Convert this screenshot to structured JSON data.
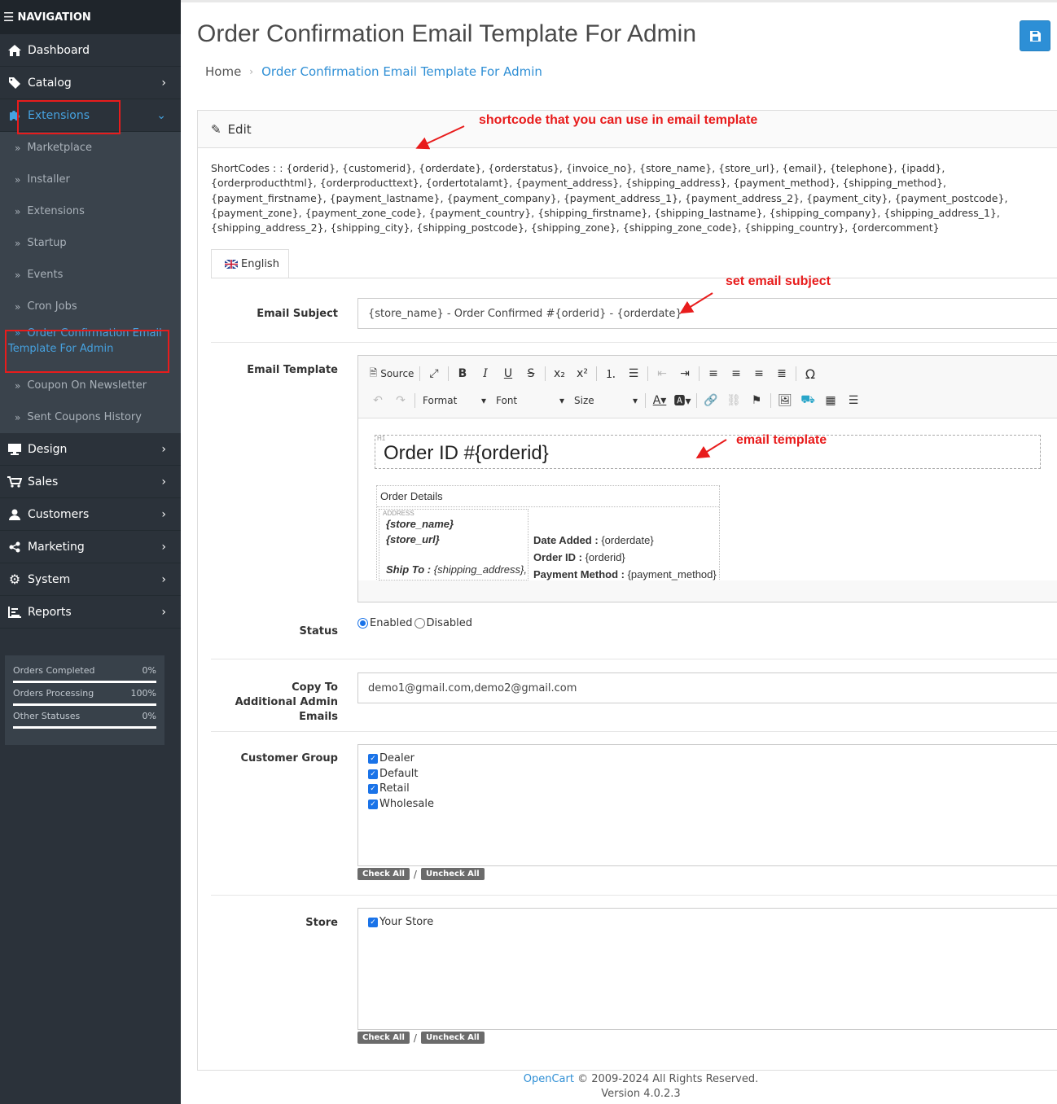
{
  "nav": {
    "header": "NAVIGATION",
    "items": [
      {
        "label": "Dashboard",
        "icon": "home-icon"
      },
      {
        "label": "Catalog",
        "icon": "tag-icon"
      },
      {
        "label": "Extensions",
        "icon": "puzzle-icon"
      },
      {
        "label": "Design",
        "icon": "monitor-icon"
      },
      {
        "label": "Sales",
        "icon": "cart-icon"
      },
      {
        "label": "Customers",
        "icon": "user-icon"
      },
      {
        "label": "Marketing",
        "icon": "share-icon"
      },
      {
        "label": "System",
        "icon": "gear-icon"
      },
      {
        "label": "Reports",
        "icon": "chart-icon"
      }
    ],
    "sub": [
      "Marketplace",
      "Installer",
      "Extensions",
      "Startup",
      "Events",
      "Cron Jobs",
      "Order Confirmation Email Template For Admin",
      "Coupon On Newsletter",
      "Sent Coupons History"
    ],
    "stats": [
      {
        "label": "Orders Completed",
        "value": "0%"
      },
      {
        "label": "Orders Processing",
        "value": "100%"
      },
      {
        "label": "Other Statuses",
        "value": "0%"
      }
    ]
  },
  "page": {
    "title": "Order Confirmation Email Template For Admin",
    "breadcrumb": {
      "home": "Home",
      "current": "Order Confirmation Email Template For Admin"
    },
    "panel_title": "Edit",
    "shortcodes": "ShortCodes : : {orderid}, {customerid}, {orderdate}, {orderstatus}, {invoice_no}, {store_name}, {store_url}, {email}, {telephone}, {ipadd}, {orderproducthtml}, {orderproducttext}, {ordertotalamt}, {payment_address}, {shipping_address}, {payment_method}, {shipping_method}, {payment_firstname}, {payment_lastname}, {payment_company}, {payment_address_1}, {payment_address_2}, {payment_city}, {payment_postcode}, {payment_zone}, {payment_zone_code}, {payment_country}, {shipping_firstname}, {shipping_lastname}, {shipping_company}, {shipping_address_1}, {shipping_address_2}, {shipping_city}, {shipping_postcode}, {shipping_zone}, {shipping_zone_code}, {shipping_country}, {ordercomment}",
    "tab": "English"
  },
  "form": {
    "subject_label": "Email Subject",
    "subject_value": "{store_name} - Order Confirmed #{orderid} - {orderdate}",
    "template_label": "Email Template",
    "toolbar": {
      "source": "Source",
      "format": "Format",
      "font": "Font",
      "size": "Size"
    },
    "editor": {
      "h1_tag": "H1",
      "h1": "Order ID #{orderid}",
      "order_details": "Order Details",
      "address_tag": "ADDRESS",
      "store_name": "{store_name}",
      "store_url": "{store_url}",
      "ship_to_label": "Ship To :",
      "ship_to_value": "{shipping_address},",
      "date_label": "Date Added :",
      "date_value": "{orderdate}",
      "orderid_label": "Order ID :",
      "orderid_value": "{orderid}",
      "pm_label": "Payment Method :",
      "pm_value": "{payment_method}"
    },
    "status_label": "Status",
    "status_enabled": "Enabled",
    "status_disabled": "Disabled",
    "copy_label": "Copy To Additional Admin Emails",
    "copy_value": "demo1@gmail.com,demo2@gmail.com",
    "cg_label": "Customer Group",
    "cg_items": [
      "Dealer",
      "Default",
      "Retail",
      "Wholesale"
    ],
    "check_all": "Check All",
    "uncheck_all": "Uncheck All",
    "slash": "/",
    "store_label": "Store",
    "store_items": [
      "Your Store"
    ]
  },
  "annotations": {
    "shortcode": "shortcode that you can use in email template",
    "subject": "set email subject",
    "template": "email template"
  },
  "footer": {
    "brand": "OpenCart",
    "copy": "© 2009-2024 All Rights Reserved.",
    "version": "Version 4.0.2.3"
  },
  "colors": {
    "accent": "#2f8fd5",
    "sidebar": "#2b323a",
    "annotation": "#e81c1c"
  }
}
